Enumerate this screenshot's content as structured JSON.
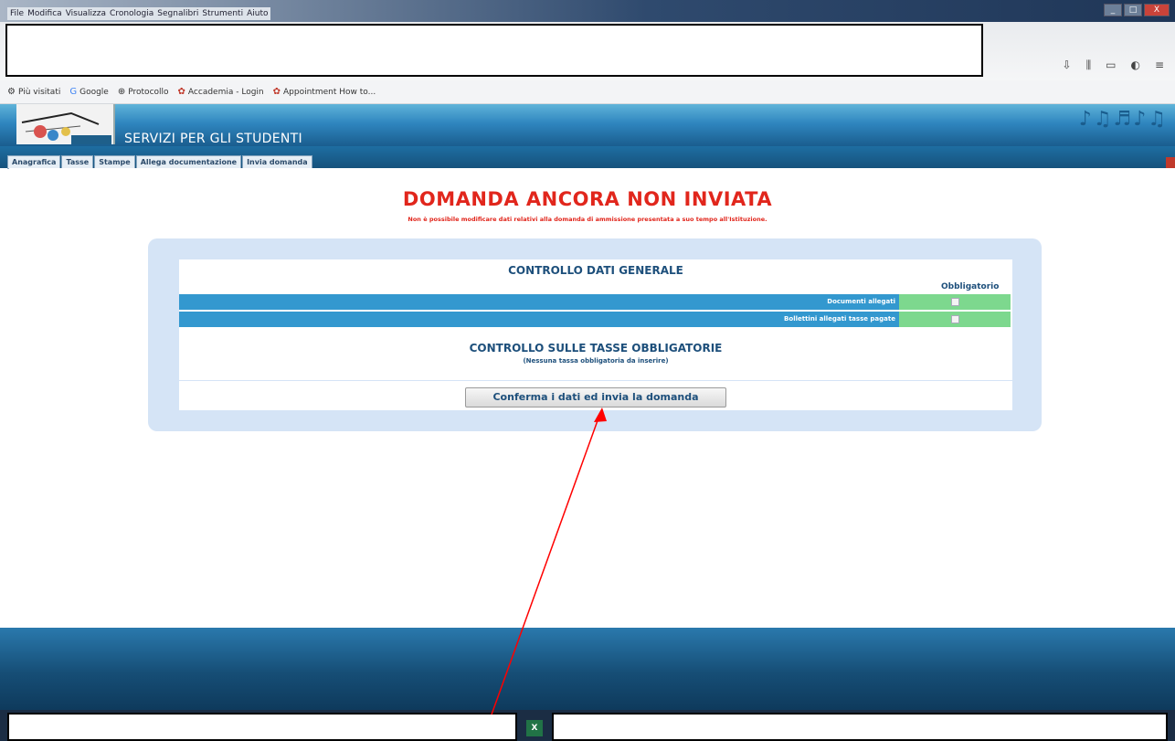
{
  "browser": {
    "menu": [
      "File",
      "Modifica",
      "Visualizza",
      "Cronologia",
      "Segnalibri",
      "Strumenti",
      "Aiuto"
    ],
    "window_buttons": [
      "_",
      "□",
      "X"
    ],
    "toolbar_icons": [
      "download-icon",
      "library-icon",
      "sidebar-icon",
      "extension-icon",
      "menu-icon"
    ],
    "bookmarks": [
      {
        "icon": "⚙",
        "label": "Più visitati"
      },
      {
        "icon": "G",
        "label": "Google"
      },
      {
        "icon": "⊕",
        "label": "Protocollo"
      },
      {
        "icon": "✿",
        "label": "Accademia - Login"
      },
      {
        "icon": "✿",
        "label": "Appointment How to..."
      }
    ]
  },
  "site": {
    "title": "SERVIZI PER GLI STUDENTI",
    "tabs": [
      "Anagrafica",
      "Tasse",
      "Stampe",
      "Allega documentazione",
      "Invia domanda"
    ]
  },
  "main": {
    "heading": "DOMANDA ANCORA NON INVIATA",
    "subheading": "Non è possibile modificare dati relativi alla domanda di ammissione presentata a suo tempo all'Istituzione.",
    "section1_title": "CONTROLLO DATI GENERALE",
    "required_label": "Obbligatorio",
    "rows": [
      "Documenti allegati",
      "Bollettini allegati tasse pagate"
    ],
    "section2_title": "CONTROLLO SULLE TASSE OBBLIGATORIE",
    "section2_sub": "(Nessuna tassa obbligatoria da inserire)",
    "confirm_button": "Conferma i dati ed invia la domanda"
  },
  "colors": {
    "heading": "#e1261c",
    "row_blue": "#3398cf",
    "check_green": "#7dd88e",
    "arrow": "#ff0000"
  }
}
